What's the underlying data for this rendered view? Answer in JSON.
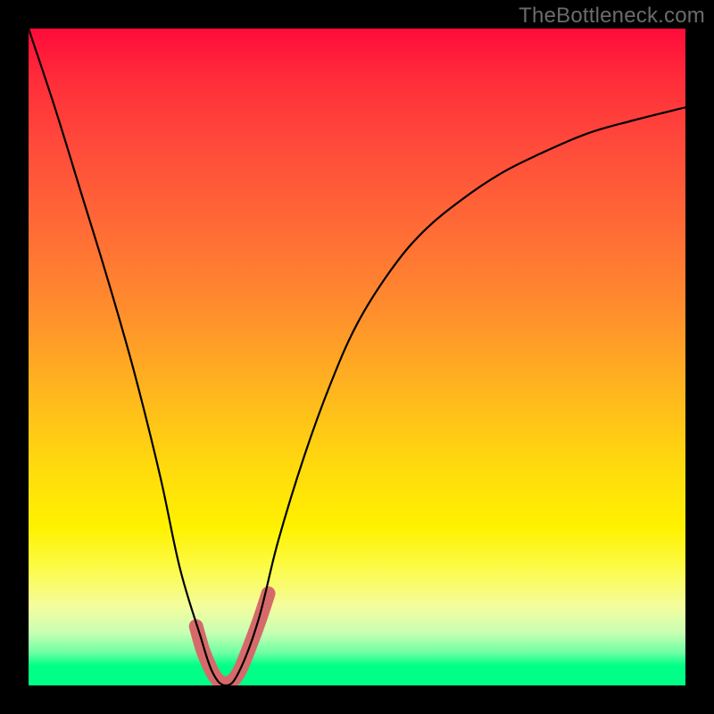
{
  "watermark": "TheBottleneck.com",
  "chart_data": {
    "type": "line",
    "title": "",
    "xlabel": "",
    "ylabel": "",
    "xlim": [
      0,
      1
    ],
    "ylim": [
      0,
      1
    ],
    "series": [
      {
        "name": "bottleneck-curve",
        "x": [
          0.0,
          0.04,
          0.08,
          0.12,
          0.16,
          0.2,
          0.23,
          0.26,
          0.28,
          0.3,
          0.32,
          0.35,
          0.38,
          0.42,
          0.46,
          0.5,
          0.55,
          0.6,
          0.66,
          0.72,
          0.78,
          0.85,
          0.92,
          1.0
        ],
        "values": [
          1.0,
          0.88,
          0.75,
          0.62,
          0.48,
          0.32,
          0.18,
          0.08,
          0.02,
          0.0,
          0.02,
          0.1,
          0.22,
          0.35,
          0.46,
          0.55,
          0.63,
          0.69,
          0.74,
          0.78,
          0.81,
          0.84,
          0.86,
          0.88
        ]
      },
      {
        "name": "minimum-marker",
        "x": [
          0.255,
          0.265,
          0.275,
          0.285,
          0.295,
          0.305,
          0.315,
          0.325,
          0.335,
          0.35,
          0.365
        ],
        "values": [
          0.09,
          0.055,
          0.03,
          0.012,
          0.004,
          0.004,
          0.012,
          0.03,
          0.055,
          0.095,
          0.14
        ]
      }
    ],
    "styles": {
      "bottleneck-curve": {
        "stroke": "#000000",
        "width": 2.2
      },
      "minimum-marker": {
        "stroke": "#d66a6a",
        "width": 16,
        "linecap": "round"
      }
    }
  }
}
